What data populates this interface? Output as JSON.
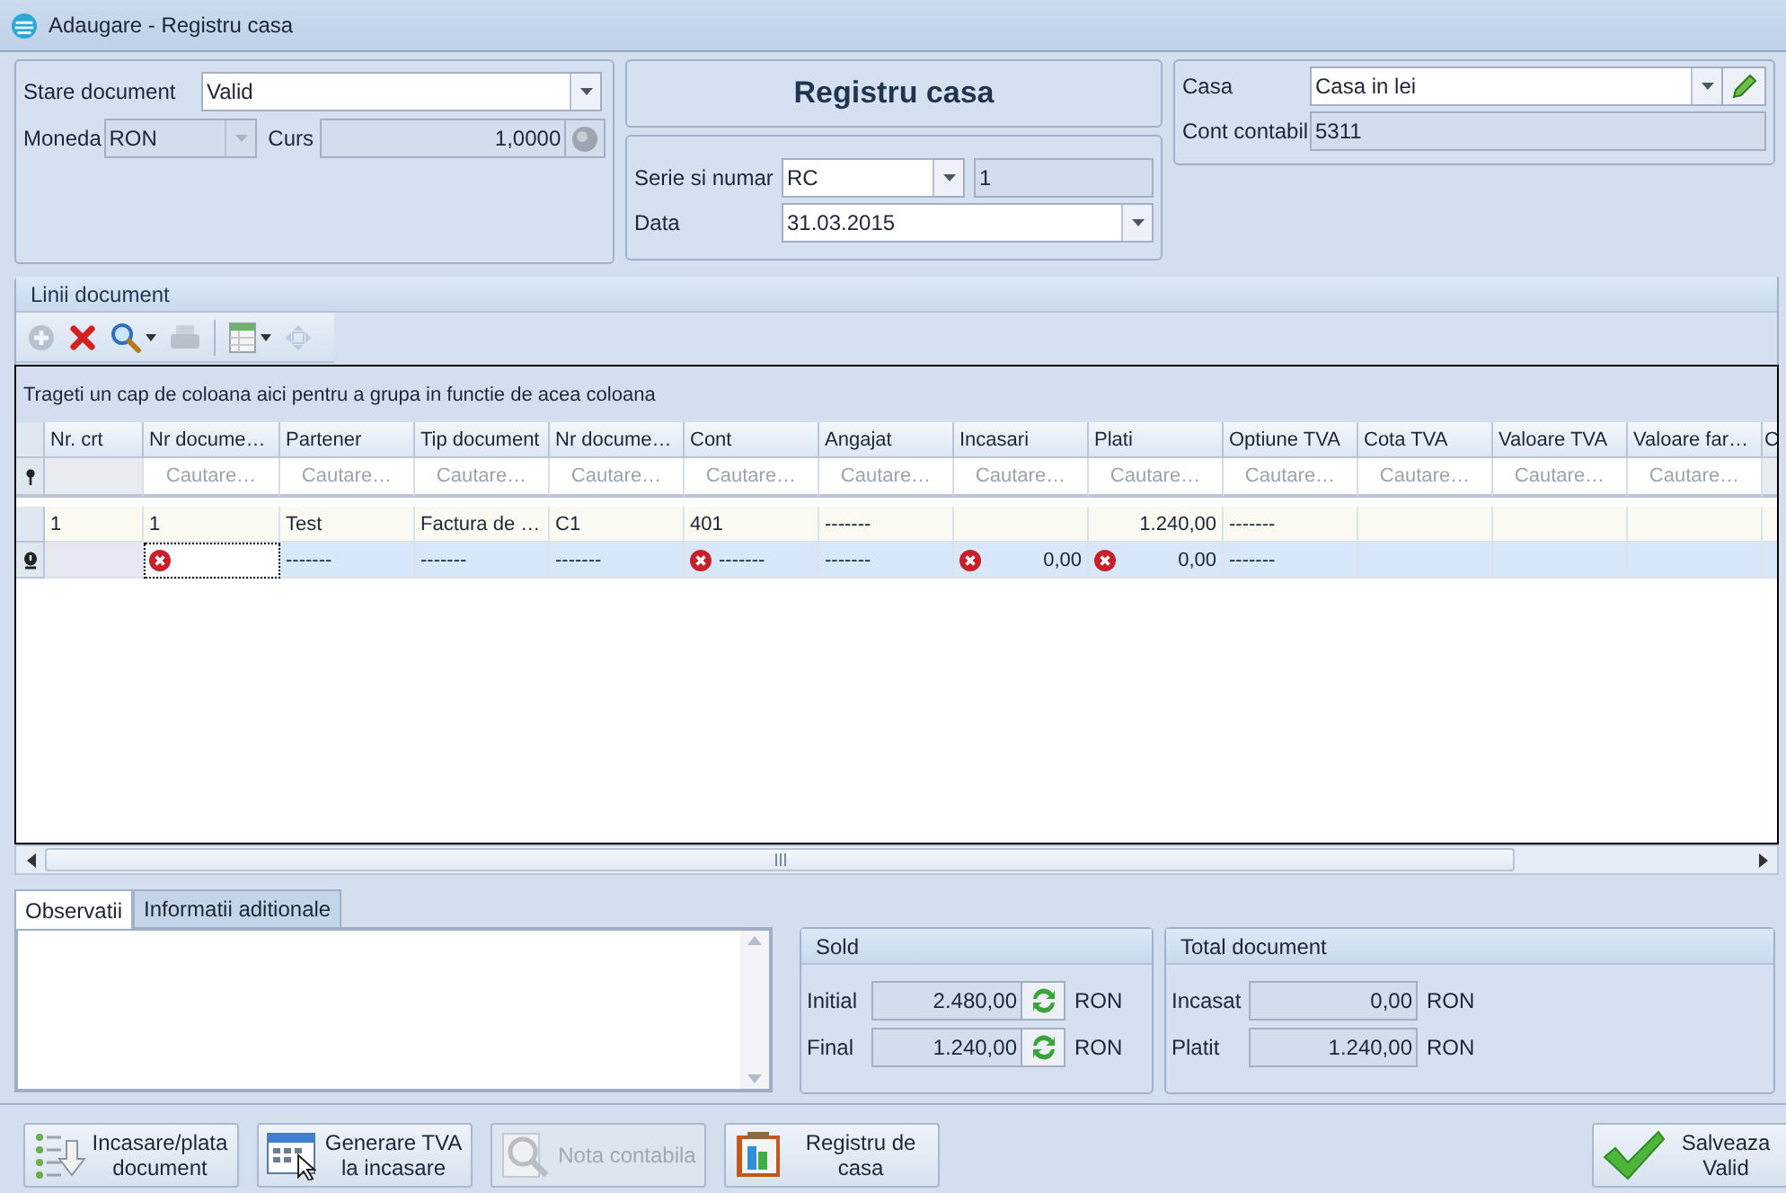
{
  "window": {
    "title": "Adaugare - Registru casa"
  },
  "document": {
    "status_label": "Stare document",
    "status": "Valid",
    "currency_label": "Moneda",
    "currency": "RON",
    "currency_disabled": true,
    "rate_label": "Curs",
    "rate": "1,0000"
  },
  "heading": "Registru casa",
  "series": {
    "label": "Serie si numar",
    "series": "RC",
    "number": "1",
    "date_label": "Data",
    "date": "31.03.2015"
  },
  "cash": {
    "label": "Casa",
    "value": "Casa in lei",
    "account_label": "Cont contabil",
    "account": "5311"
  },
  "lines": {
    "title": "Linii document",
    "toolbar": [
      {
        "kind": "add",
        "disabled": true,
        "dropdown": false
      },
      {
        "kind": "delete",
        "disabled": false,
        "dropdown": false
      },
      {
        "kind": "search",
        "disabled": false,
        "dropdown": true
      },
      {
        "kind": "print",
        "disabled": true,
        "dropdown": false
      },
      {
        "kind": "export",
        "disabled": false,
        "dropdown": true
      },
      {
        "kind": "move",
        "disabled": true,
        "dropdown": false
      }
    ],
    "group_hint": "Trageti un cap de coloana aici pentru a grupa in functie de acea coloana",
    "columns": [
      {
        "label": "Nr. crt",
        "kind": "text"
      },
      {
        "label": "Nr docume…",
        "filter": "Cautare…",
        "kind": "text"
      },
      {
        "label": "Partener",
        "filter": "Cautare…",
        "kind": "text"
      },
      {
        "label": "Tip document",
        "filter": "Cautare…",
        "kind": "text"
      },
      {
        "label": "Nr docume…",
        "filter": "Cautare…",
        "kind": "text"
      },
      {
        "label": "Cont",
        "filter": "Cautare…",
        "kind": "text"
      },
      {
        "label": "Angajat",
        "filter": "Cautare…",
        "kind": "text"
      },
      {
        "label": "Incasari",
        "filter": "Cautare…",
        "kind": "number"
      },
      {
        "label": "Plati",
        "filter": "Cautare…",
        "kind": "number"
      },
      {
        "label": "Optiune TVA",
        "filter": "Cautare…",
        "kind": "text"
      },
      {
        "label": "Cota TVA",
        "filter": "Cautare…",
        "kind": "text"
      },
      {
        "label": "Valoare TVA",
        "filter": "Cautare…",
        "kind": "text"
      },
      {
        "label": "Valoare far…",
        "filter": "Cautare…",
        "kind": "text"
      },
      {
        "label": "C",
        "kind": "text"
      }
    ],
    "rows": [
      {
        "selected": false,
        "invalid": false,
        "cells": [
          {
            "text": "1",
            "error": false,
            "focused": false
          },
          {
            "text": "1",
            "error": false,
            "focused": false
          },
          {
            "text": "Test",
            "error": false,
            "focused": false
          },
          {
            "text": "Factura de …",
            "error": false,
            "focused": false
          },
          {
            "text": "C1",
            "error": false,
            "focused": false
          },
          {
            "text": "401",
            "error": false,
            "focused": false
          },
          {
            "text": "-------",
            "error": false,
            "focused": false
          },
          {
            "error": false,
            "focused": false
          },
          {
            "text": "1.240,00",
            "error": false,
            "focused": false
          },
          {
            "text": "-------",
            "error": false,
            "focused": false
          },
          {
            "error": false,
            "focused": false
          },
          {
            "error": false,
            "focused": false
          },
          {
            "error": false,
            "focused": false
          },
          {
            "error": false,
            "focused": false
          }
        ]
      },
      {
        "selected": true,
        "invalid": true,
        "cells": [
          {
            "error": false,
            "focused": false
          },
          {
            "error": true,
            "focused": true
          },
          {
            "text": "-------",
            "error": false,
            "focused": false
          },
          {
            "text": "-------",
            "error": false,
            "focused": false
          },
          {
            "text": "-------",
            "error": false,
            "focused": false
          },
          {
            "text": "-------",
            "error": true,
            "focused": false
          },
          {
            "text": "-------",
            "error": false,
            "focused": false
          },
          {
            "text": "0,00",
            "error": true,
            "focused": false
          },
          {
            "text": "0,00",
            "error": true,
            "focused": false
          },
          {
            "text": "-------",
            "error": false,
            "focused": false
          },
          {
            "error": false,
            "focused": false
          },
          {
            "error": false,
            "focused": false
          },
          {
            "error": false,
            "focused": false
          },
          {
            "error": false,
            "focused": false
          }
        ]
      }
    ]
  },
  "tabs": [
    {
      "label": "Observatii",
      "selected": true
    },
    {
      "label": "Informatii aditionale",
      "selected": false
    }
  ],
  "balance": {
    "title": "Sold",
    "rows": [
      {
        "label": "Initial",
        "value": "2.480,00",
        "unit": "RON"
      },
      {
        "label": "Final",
        "value": "1.240,00",
        "unit": "RON"
      }
    ]
  },
  "totals": {
    "title": "Total document",
    "rows": [
      {
        "label": "Incasat",
        "value": "0,00",
        "unit": "RON"
      },
      {
        "label": "Platit",
        "value": "1.240,00",
        "unit": "RON"
      }
    ]
  },
  "buttons": [
    {
      "kind": "payment",
      "label": "Incasare/plata\ndocument",
      "disabled": false
    },
    {
      "kind": "vat",
      "label": "Generare TVA\nla incasare",
      "disabled": false
    },
    {
      "kind": "ledger",
      "label": "Nota contabila",
      "disabled": true
    },
    {
      "kind": "register",
      "label": "Registru de\ncasa",
      "disabled": false
    },
    {
      "kind": "save",
      "label": "Salveaza\nValid",
      "disabled": false
    }
  ]
}
